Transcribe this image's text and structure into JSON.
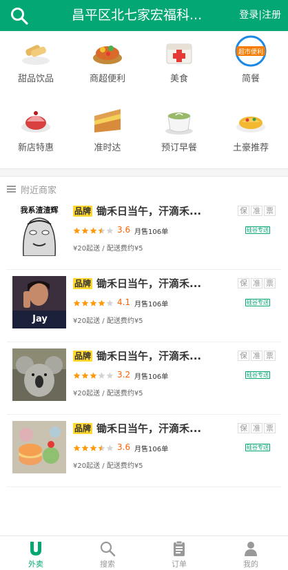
{
  "header": {
    "title": "昌平区北七家宏福科...",
    "login": "登录|注册"
  },
  "categories": [
    {
      "label": "甜品饮品",
      "icon": "dessert-icon"
    },
    {
      "label": "商超便利",
      "icon": "supermarket-icon"
    },
    {
      "label": "美食",
      "icon": "food-icon"
    },
    {
      "label": "简餐",
      "icon": "quick-meal-icon"
    },
    {
      "label": "新店特惠",
      "icon": "new-shop-icon"
    },
    {
      "label": "准时达",
      "icon": "on-time-icon"
    },
    {
      "label": "预订早餐",
      "icon": "breakfast-icon"
    },
    {
      "label": "土豪推荐",
      "icon": "recommend-icon"
    }
  ],
  "nearby": {
    "title": "附近商家"
  },
  "shops": [
    {
      "brand": "品牌",
      "name": "锄禾日当午，汗滴禾...",
      "tags": [
        "保",
        "准",
        "票"
      ],
      "rating": "3.6",
      "stars": 3.5,
      "sales": "月售106单",
      "delivery": "硅谷专送",
      "fees": "¥20起送 / 配送费约¥5"
    },
    {
      "brand": "品牌",
      "name": "锄禾日当午，汗滴禾...",
      "tags": [
        "保",
        "准",
        "票"
      ],
      "rating": "4.1",
      "stars": 4,
      "sales": "月售106单",
      "delivery": "硅谷专送",
      "fees": "¥20起送 / 配送费约¥5"
    },
    {
      "brand": "品牌",
      "name": "锄禾日当午，汗滴禾...",
      "tags": [
        "保",
        "准",
        "票"
      ],
      "rating": "3.2",
      "stars": 3,
      "sales": "月售106单",
      "delivery": "硅谷专送",
      "fees": "¥20起送 / 配送费约¥5"
    },
    {
      "brand": "品牌",
      "name": "锄禾日当午，汗滴禾...",
      "tags": [
        "保",
        "准",
        "票"
      ],
      "rating": "3.6",
      "stars": 3.5,
      "sales": "月售106单",
      "delivery": "硅谷专送",
      "fees": "¥20起送 / 配送费约¥5"
    }
  ],
  "shop_images": [
    {
      "name": "shop-thumb-meme",
      "caption": "我系渣渣辉"
    },
    {
      "name": "shop-thumb-singer",
      "caption": "Jay"
    },
    {
      "name": "shop-thumb-koala",
      "caption": ""
    },
    {
      "name": "shop-thumb-macaron",
      "caption": ""
    }
  ],
  "footer": {
    "tabs": [
      {
        "label": "外卖",
        "icon": "takeout-icon",
        "active": true
      },
      {
        "label": "搜索",
        "icon": "search-icon",
        "active": false
      },
      {
        "label": "订单",
        "icon": "order-icon",
        "active": false
      },
      {
        "label": "我的",
        "icon": "profile-icon",
        "active": false
      }
    ]
  },
  "colors": {
    "primary": "#02a774",
    "star": "#ff9a0d",
    "star_off": "#d4d4d4",
    "brand_badge": "#ffd930",
    "rating": "#ff6000"
  }
}
